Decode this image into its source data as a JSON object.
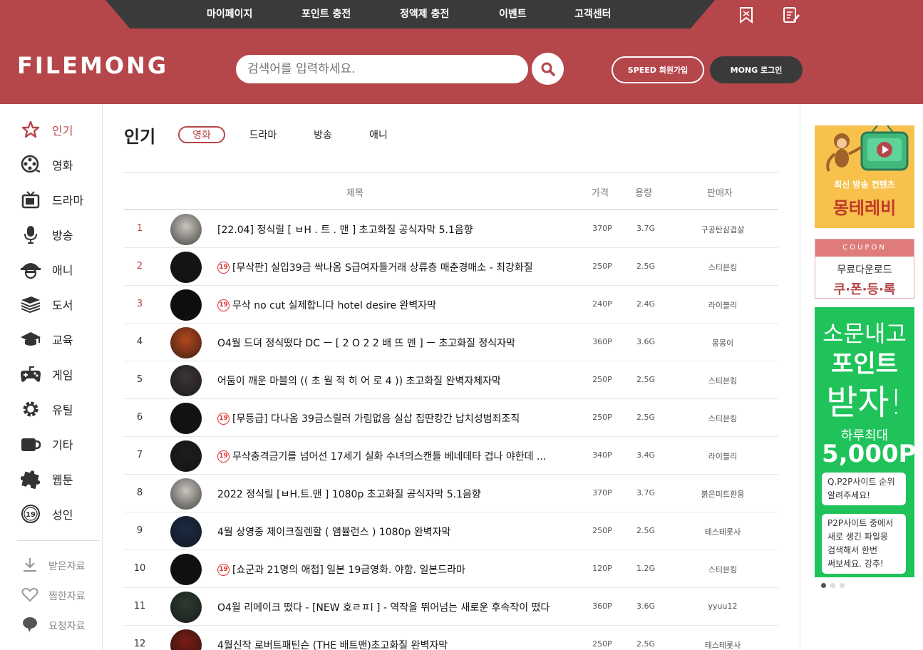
{
  "topnav": [
    "마이페이지",
    "포인트 충전",
    "정액제 충전",
    "이벤트",
    "고객센터"
  ],
  "logo": "FILEMONG",
  "search": {
    "placeholder": "검색어를 입력하세요."
  },
  "auth": {
    "join": "SPEED 회원가입",
    "login": "MONG 로그인"
  },
  "sidebar": {
    "items": [
      {
        "label": "인기",
        "icon": "star-icon"
      },
      {
        "label": "영화",
        "icon": "film-reel-icon"
      },
      {
        "label": "드라마",
        "icon": "tv-icon"
      },
      {
        "label": "방송",
        "icon": "microphone-icon"
      },
      {
        "label": "애니",
        "icon": "character-icon"
      },
      {
        "label": "도서",
        "icon": "books-icon"
      },
      {
        "label": "교육",
        "icon": "graduation-cap-icon"
      },
      {
        "label": "게임",
        "icon": "gamepad-icon"
      },
      {
        "label": "유틸",
        "icon": "gear-icon"
      },
      {
        "label": "기타",
        "icon": "cup-icon"
      },
      {
        "label": "웹툰",
        "icon": "puzzle-icon"
      },
      {
        "label": "성인",
        "icon": "adult-19-icon"
      }
    ],
    "sub": [
      {
        "label": "받은자료",
        "icon": "download-icon"
      },
      {
        "label": "찜한자료",
        "icon": "heart-icon"
      },
      {
        "label": "요청자료",
        "icon": "speech-bubble-icon"
      }
    ]
  },
  "main": {
    "title": "인기",
    "tabs": [
      "영화",
      "드라마",
      "방송",
      "애니"
    ],
    "columns": {
      "title": "제목",
      "price": "가격",
      "size": "용량",
      "seller": "판매자"
    },
    "rows": [
      {
        "rank": "1",
        "adult": false,
        "title": "[22.04] 정식릴 [ ㅂH . 트 . 맨 ] 초고화질 공식자막 5.1음향",
        "price": "370P",
        "size": "3.7G",
        "seller": "구공탄삼겹살",
        "thumb": "#c9c4be"
      },
      {
        "rank": "2",
        "adult": true,
        "title": "[무삭판] 실입39금 싹나옴 S급여자들거래 상류층 매춘경매소 - 최강화질",
        "price": "250P",
        "size": "2.5G",
        "seller": "스티븐킹",
        "thumb": "#151515"
      },
      {
        "rank": "3",
        "adult": true,
        "title": "무삭 no cut 실제합니다 hotel desire 완벽자막",
        "price": "240P",
        "size": "2.4G",
        "seller": "라이블리",
        "thumb": "#0d0d0d"
      },
      {
        "rank": "4",
        "adult": false,
        "title": "O4월 드뎌 정식떴다 DC ㅡ [ 2 O 2 2 배 뜨 멘 ] ㅡ 초고화질 정식자막",
        "price": "360P",
        "size": "3.6G",
        "seller": "몽몽이",
        "thumb": "#b4471c"
      },
      {
        "rank": "5",
        "adult": false,
        "title": "어둠이 깨운 마블의 (( 초 월 적 히 어 로 4 )) 초고화질 완벽자체자막",
        "price": "250P",
        "size": "2.5G",
        "seller": "스티븐킹",
        "thumb": "#3b3338"
      },
      {
        "rank": "6",
        "adult": true,
        "title": "[무등급] 다나옴 39금스릴러 가림없음 실삽 집딴캉간 납치성범죄조직",
        "price": "250P",
        "size": "2.5G",
        "seller": "스티븐킹",
        "thumb": "#121212"
      },
      {
        "rank": "7",
        "adult": true,
        "title": "무삭충격금기를 넘어선 17세기 실화 수녀의스캔들 베네데타 겁나 야한데 ...",
        "price": "340P",
        "size": "3.4G",
        "seller": "라이블리",
        "thumb": "#1d1d1d"
      },
      {
        "rank": "8",
        "adult": false,
        "title": "2022 정식릴 [ㅂH.트.맨 ] 1080p 초고화질 공식자막 5.1음향",
        "price": "370P",
        "size": "3.7G",
        "seller": "붉은미트환웅",
        "thumb": "#c9c4be"
      },
      {
        "rank": "9",
        "adult": false,
        "title": "4월 상영중 제이크질렌할 ( 앰뷸런스 ) 1080p 완벽자막",
        "price": "250P",
        "size": "2.5G",
        "seller": "테스테롯사",
        "thumb": "#1a2a45"
      },
      {
        "rank": "10",
        "adult": true,
        "title": "[쇼군과 21명의 애첩] 일본 19금영화. 야함. 일본드라마",
        "price": "120P",
        "size": "1.2G",
        "seller": "스티븐킹",
        "thumb": "#0f0f0f"
      },
      {
        "rank": "11",
        "adult": false,
        "title": "O4월 리메이크 떴다 - [NEW 호ㄹㅍl ] - 역작을 뛰어넘는 새로운 후속작이 떴다",
        "price": "360P",
        "size": "3.6G",
        "seller": "yyuu12",
        "thumb": "#2d3a30"
      },
      {
        "rank": "12",
        "adult": false,
        "title": "4월신작 로버트패틴슨 (THE 배트맨)초고화질 완벽자막",
        "price": "250P",
        "size": "2.5G",
        "seller": "테스테롯사",
        "thumb": "#7a1c14"
      }
    ]
  },
  "ads": {
    "tv": {
      "line1": "최신 방송 컨텐츠",
      "line2": "몽테레비"
    },
    "coupon": {
      "top": "COUPON",
      "line1": "무료다운로드",
      "line2": "쿠·폰·등·록"
    },
    "green": {
      "l1": "소문내고",
      "l2": "포인트",
      "l3": "받자!",
      "l4": "하루최대",
      "l5": "5,000P",
      "q1": "Q.P2P사이트 순위",
      "q2": "알려주세요!",
      "a1": "P2P사이트 중에서",
      "a2": "새로 생긴 파일몽",
      "a3": "검색해서 한번",
      "a4": "써보세요. 강추!"
    }
  },
  "colors": {
    "brand": "#b5464a",
    "dark": "#3a3a3a",
    "green": "#1fc35a"
  }
}
